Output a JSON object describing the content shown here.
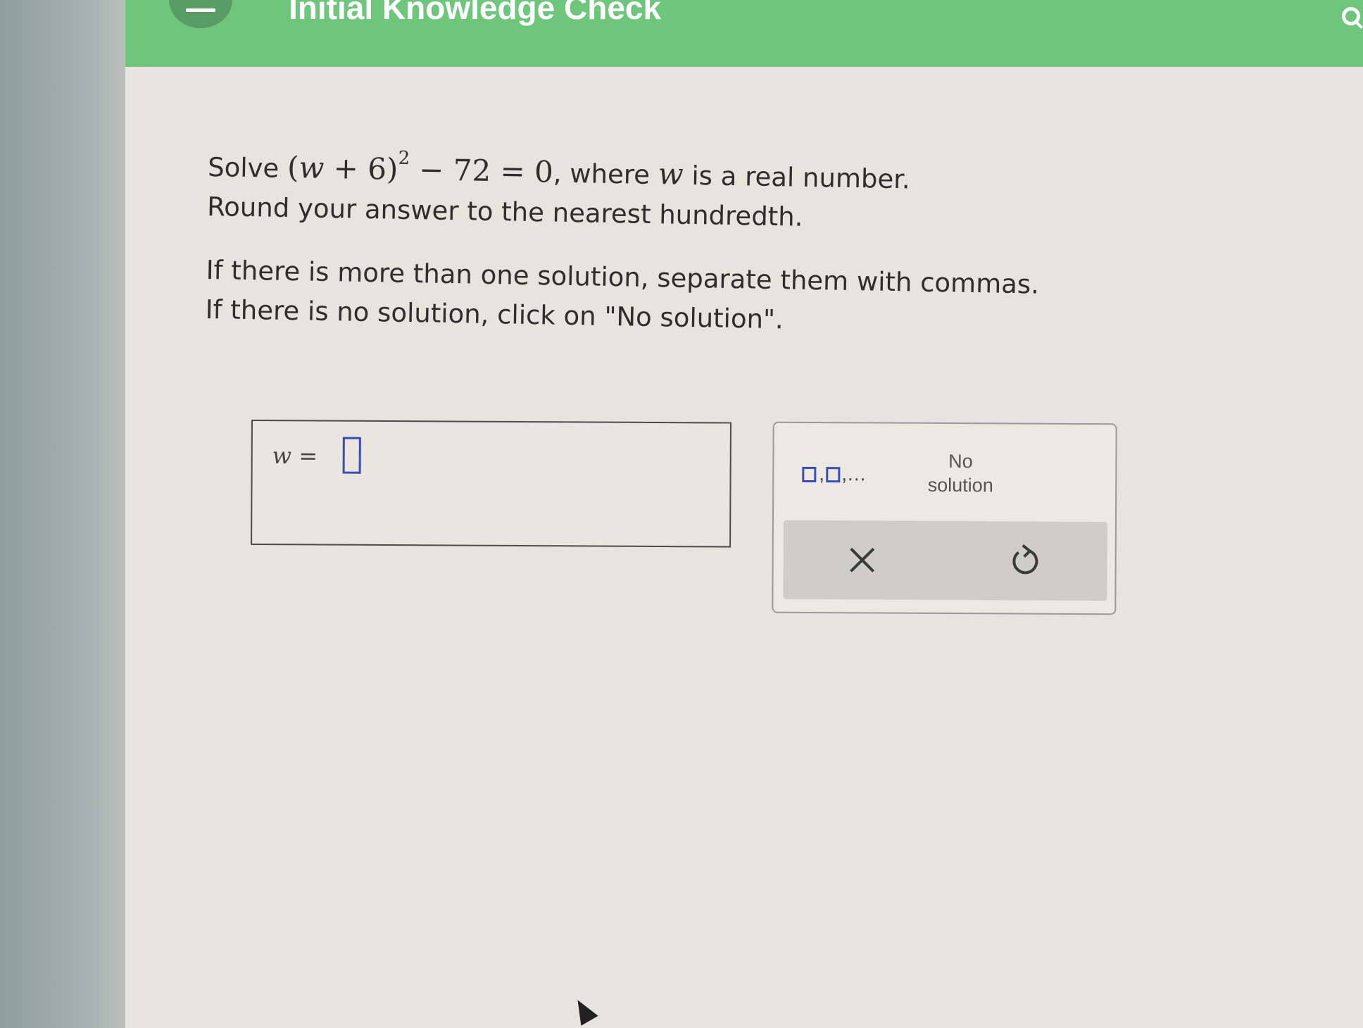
{
  "header": {
    "title": "Initial Knowledge Check"
  },
  "question": {
    "solve_word": "Solve",
    "eq_open": "(",
    "var": "w",
    "eq_plus": " + 6)",
    "exponent": "2",
    "eq_rest": " − 72 = 0",
    "where_text": ", where ",
    "where_var": "w",
    "tail_text": " is a real number.",
    "line2": "Round your answer to the nearest hundredth.",
    "line3": "If there is more than one solution, separate them with commas.",
    "line4": "If there is no solution, click on \"No solution\"."
  },
  "answer": {
    "var": "w",
    "equals": " = ",
    "value": ""
  },
  "keypad": {
    "comma_glyph": ",",
    "ellipsis_glyph": ",...",
    "no_solution_line1": "No",
    "no_solution_line2": "solution",
    "clear_glyph": "×"
  },
  "colors": {
    "header_green": "#6ec57b",
    "input_border_blue": "#3d4db8",
    "panel_bg": "#e7e3dd"
  }
}
